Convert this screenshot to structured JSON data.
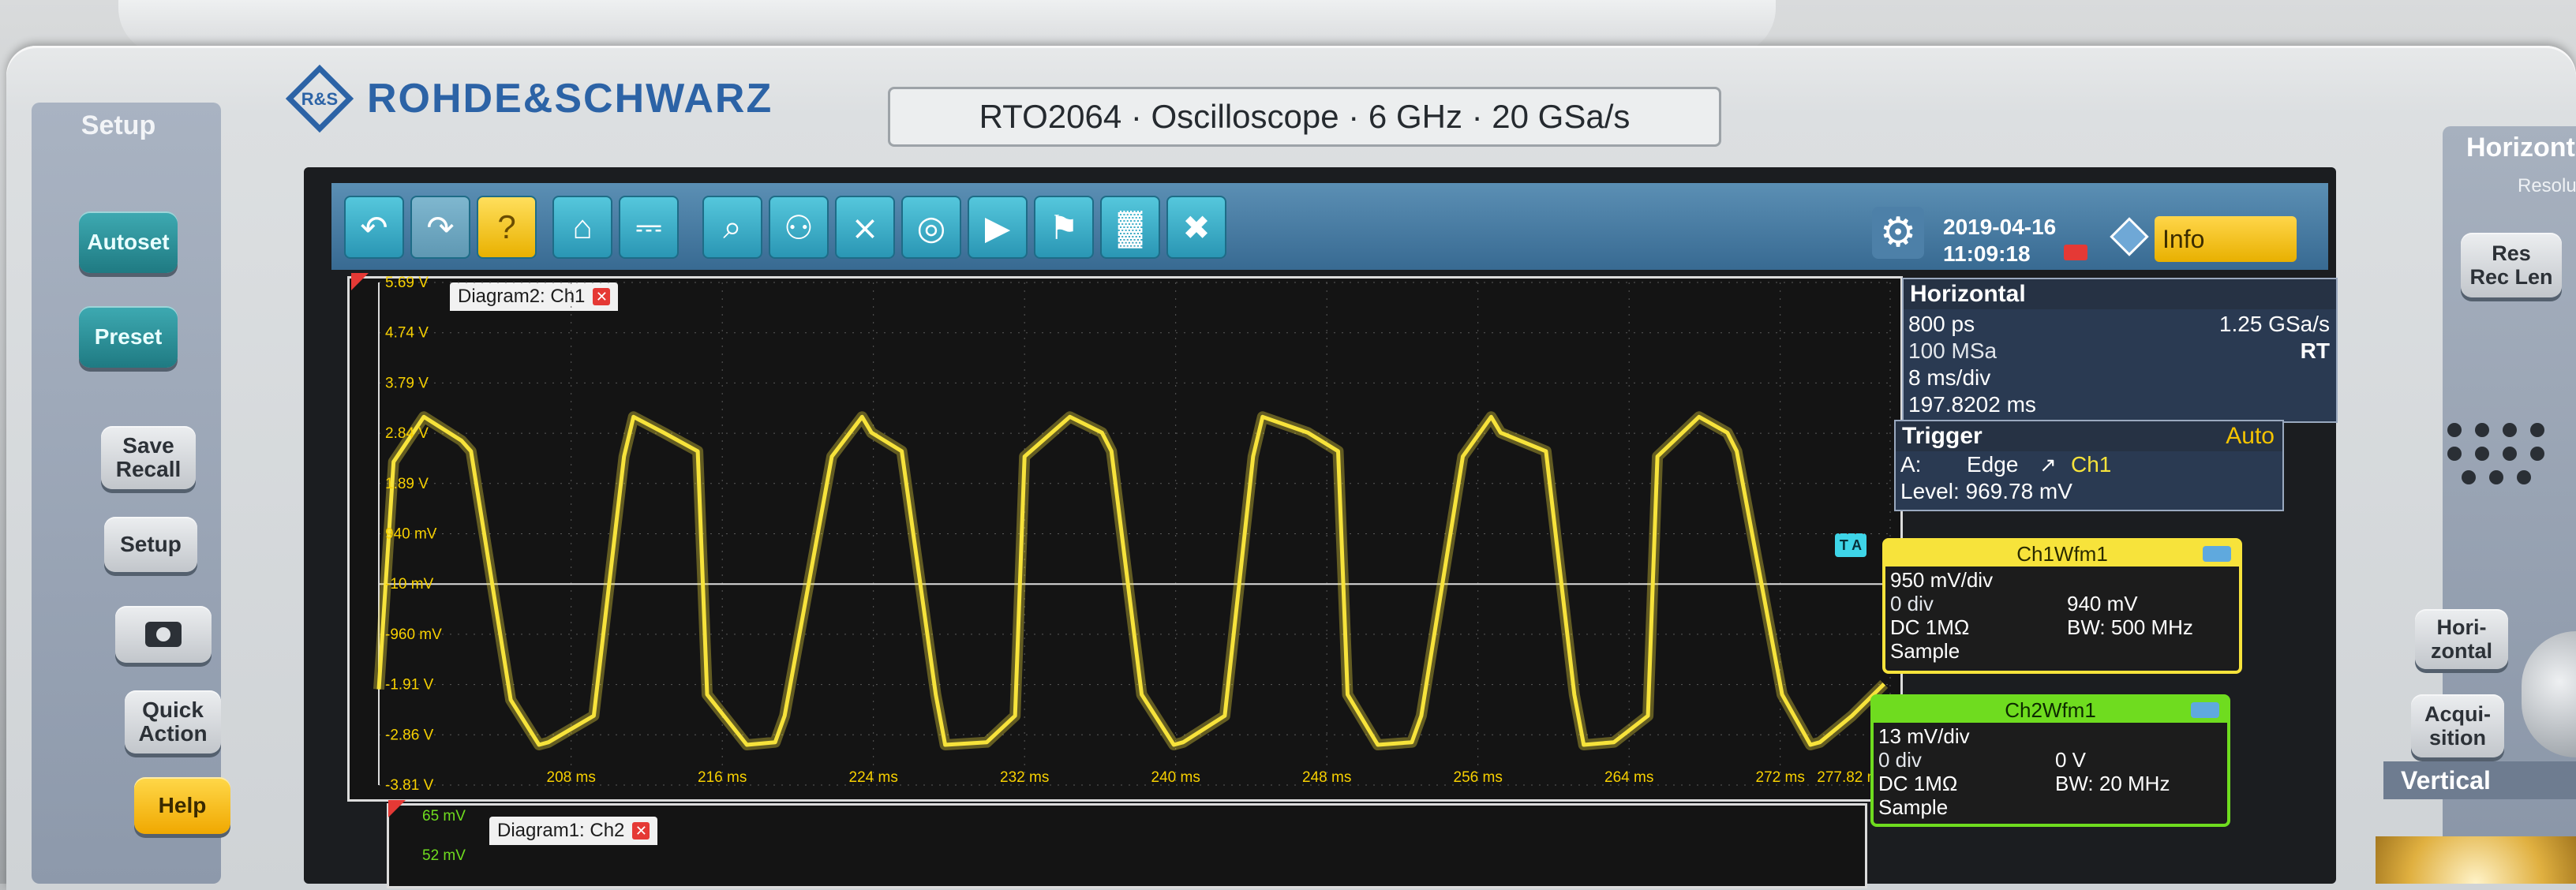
{
  "brand": "ROHDE&SCHWARZ",
  "model_label": "RTO2064 · Oscilloscope · 6 GHz · 20 GSa/s",
  "left_panel": {
    "title": "Setup",
    "buttons": [
      {
        "label": "Autoset"
      },
      {
        "label": "Preset"
      },
      {
        "label": "Save\nRecall"
      },
      {
        "label": "Setup"
      },
      {
        "label": "Quick\nAction"
      },
      {
        "label": "Help"
      }
    ]
  },
  "right_panel": {
    "title": "Horizonta",
    "subtitle": "Resolutio",
    "buttons": [
      {
        "label": "Res\nRec Len"
      },
      {
        "label": "Hori-\nzontal"
      },
      {
        "label": "Acqui-\nsition"
      }
    ],
    "vertical_label": "Vertical"
  },
  "status": {
    "date": "2019-04-16",
    "time": "11:09:18",
    "info_label": "Info"
  },
  "horizontal": {
    "header": "Horizontal",
    "row1_left": "800 ps",
    "row1_right": "1.25 GSa/s",
    "row2_left": "100 MSa",
    "row2_right": "RT",
    "row3": "8 ms/div",
    "row4": "197.8202 ms"
  },
  "trigger": {
    "header": "Trigger",
    "mode": "Auto",
    "source_prefix": "A:",
    "type": "Edge",
    "channel": "Ch1",
    "level": "Level: 969.78 mV"
  },
  "ch1": {
    "title": "Ch1Wfm1",
    "scale": "950 mV/div",
    "offset_div": "0 div",
    "offset_value": "940 mV",
    "coupling": "DC 1MΩ",
    "bandwidth": "BW: 500 MHz",
    "mode": "Sample"
  },
  "ch2": {
    "title": "Ch2Wfm1",
    "scale": "13 mV/div",
    "offset_div": "0 div",
    "offset_value": "0 V",
    "coupling": "DC 1MΩ",
    "bandwidth": "BW: 20 MHz",
    "mode": "Sample"
  },
  "diagram2": {
    "tab_label": "Diagram2: Ch1",
    "marker_label": "T A"
  },
  "diagram1": {
    "tab_label": "Diagram1: Ch2",
    "y_top": "65 mV",
    "y_second": "52 mV"
  },
  "colors": {
    "ch1": "#f7e33b",
    "ch2": "#6fdc1f",
    "accent_teal": "#2a96b4",
    "info_yellow": "#f5c400"
  },
  "chart_data": {
    "type": "line",
    "title": "",
    "xlabel": "",
    "ylabel": "",
    "y_tick_labels": [
      "5.69 V",
      "4.74 V",
      "3.79 V",
      "2.84 V",
      "1.89 V",
      "940 mV",
      "-10 mV",
      "-960 mV",
      "-1.91 V",
      "-2.86 V",
      "-3.81 V"
    ],
    "y_values_V": [
      5.69,
      4.74,
      3.79,
      2.84,
      1.89,
      0.94,
      -0.01,
      -0.96,
      -1.91,
      -2.86,
      -3.81
    ],
    "x_tick_labels": [
      "208 ms",
      "216 ms",
      "224 ms",
      "232 ms",
      "240 ms",
      "248 ms",
      "256 ms",
      "264 ms",
      "272 ms",
      "277.82 ms"
    ],
    "x_values_ms": [
      208,
      216,
      224,
      232,
      240,
      248,
      256,
      264,
      272,
      277.82
    ],
    "xlim_ms": [
      197.82,
      277.82
    ],
    "ylim_V": [
      -3.81,
      5.69
    ],
    "grid": true,
    "series": [
      {
        "name": "Ch1",
        "x_ms": [
          197.82,
          198.6,
          200.2,
          202.2,
          202.7,
          204.8,
          206.3,
          206.8,
          209.2,
          210.8,
          211.3,
          212.9,
          214.7,
          215.2,
          217.3,
          218.8,
          219.3,
          221.8,
          223.4,
          223.9,
          225.5,
          227.3,
          227.8,
          230.0,
          231.5,
          232.0,
          234.4,
          236.1,
          236.6,
          238.2,
          239.9,
          240.4,
          242.6,
          244.1,
          244.6,
          247.0,
          248.6,
          249.1,
          250.7,
          252.5,
          253.0,
          255.2,
          256.7,
          257.2,
          259.6,
          261.1,
          261.6,
          263.2,
          265.0,
          265.5,
          267.7,
          269.2,
          269.7,
          272.1,
          273.6,
          274.1,
          275.8,
          277.5
        ],
        "y_V": [
          -2.0,
          2.3,
          3.15,
          2.7,
          2.5,
          -2.2,
          -3.05,
          -3.0,
          -2.5,
          2.4,
          3.15,
          2.85,
          2.5,
          -2.1,
          -3.05,
          -3.0,
          -2.5,
          2.4,
          3.15,
          2.85,
          2.5,
          -2.1,
          -3.05,
          -3.0,
          -2.5,
          2.4,
          3.15,
          2.85,
          2.5,
          -2.1,
          -3.05,
          -3.0,
          -2.5,
          2.4,
          3.15,
          2.85,
          2.5,
          -2.1,
          -3.05,
          -3.0,
          -2.5,
          2.4,
          3.15,
          2.85,
          2.5,
          -2.1,
          -3.05,
          -3.0,
          -2.5,
          2.4,
          3.15,
          2.85,
          2.5,
          -2.1,
          -3.05,
          -3.0,
          -2.5,
          -1.9
        ]
      }
    ]
  }
}
